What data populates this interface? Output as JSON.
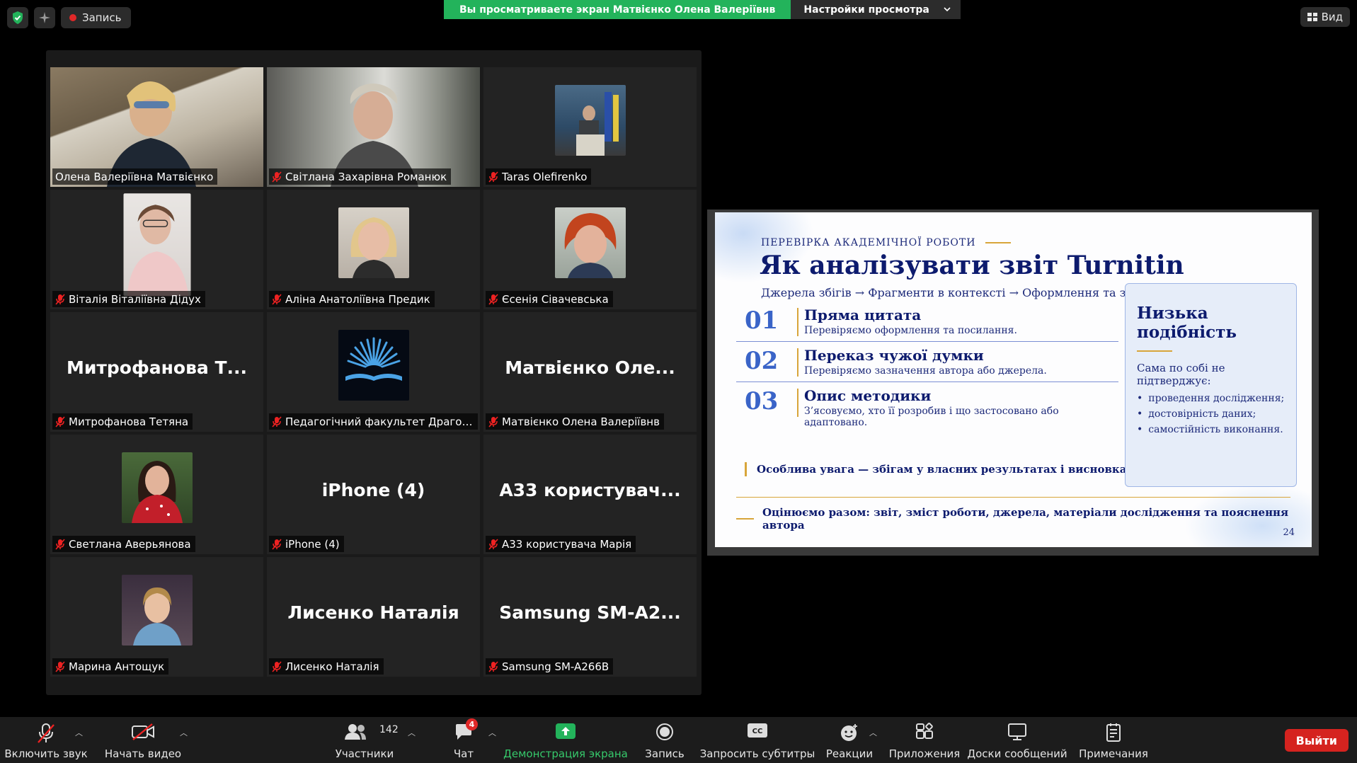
{
  "top": {
    "recording_label": "Запись",
    "share_banner": "Вы просматриваете экран Матвієнко Олена Валеріївнв",
    "view_settings": "Настройки просмотра",
    "view_label": "Вид"
  },
  "tiles": [
    {
      "display_name": "Олена Валеріївна Матвієнко",
      "type": "video",
      "muted": false,
      "active": true
    },
    {
      "display_name": "Світлана Захарівна Романюк",
      "type": "video",
      "muted": true
    },
    {
      "display_name": "Taras Olefirenko",
      "type": "photo",
      "muted": true
    },
    {
      "display_name": "Віталія Віталіївна Дідух",
      "type": "photo",
      "muted": true
    },
    {
      "display_name": "Аліна Анатоліївна Предик",
      "type": "photo",
      "muted": true
    },
    {
      "display_name": "Єсенія Сівачевська",
      "type": "photo",
      "muted": true
    },
    {
      "display_name": "Митрофанова Тетяна",
      "big_text": "Митрофанова Т...",
      "type": "text",
      "muted": true
    },
    {
      "display_name": "Педагогічний факультет Драгомано...",
      "type": "logo",
      "muted": true
    },
    {
      "display_name": "Матвієнко Олена Валеріївнв",
      "big_text": "Матвієнко Оле...",
      "type": "text",
      "muted": true
    },
    {
      "display_name": "Светлана Аверьянова",
      "type": "photo",
      "muted": true
    },
    {
      "display_name": "iPhone (4)",
      "big_text": "iPhone (4)",
      "type": "text",
      "muted": true
    },
    {
      "display_name": "А33 користувача Марія",
      "big_text": "А33  користувач...",
      "type": "text",
      "muted": true
    },
    {
      "display_name": "Марина Антощук",
      "type": "photo",
      "muted": true
    },
    {
      "display_name": "Лисенко Наталія",
      "big_text": "Лисенко Наталія",
      "type": "text",
      "muted": true
    },
    {
      "display_name": "Samsung SM-A266B",
      "big_text": "Samsung  SM-A2...",
      "type": "text",
      "muted": true
    }
  ],
  "slide": {
    "kicker": "ПЕРЕВІРКА АКАДЕМІЧНОЇ РОБОТИ",
    "title": "Як аналізувати звіт Turnitin",
    "subtitle": "Джерела збігів  →  Фрагменти в контексті  →  Оформлення та зміст",
    "items": [
      {
        "num": "01",
        "head": "Пряма цитата",
        "desc": "Перевіряємо оформлення та посилання."
      },
      {
        "num": "02",
        "head": "Переказ чужої думки",
        "desc": "Перевіряємо зазначення автора або джерела."
      },
      {
        "num": "03",
        "head": "Опис методики",
        "desc": "З’ясовуємо, хто її розробив і що застосовано або адаптовано."
      }
    ],
    "note": "Особлива увага — збігам у власних результатах і висновках",
    "box": {
      "title": "Низька подібність",
      "lead": "Сама по собі не підтверджує:",
      "bullets": [
        "проведення дослідження;",
        "достовірність даних;",
        "самостійність виконання."
      ]
    },
    "footer": "Оцінюємо разом: звіт, зміст роботи, джерела, матеріали дослідження та пояснення автора",
    "page": "24"
  },
  "toolbar": {
    "mute": "Включить звук",
    "video": "Начать видео",
    "participants": "Участники",
    "participants_count": "142",
    "chat": "Чат",
    "chat_badge": "4",
    "share": "Демонстрация экрана",
    "record": "Запись",
    "captions": "Запросить субтитры",
    "reactions": "Реакции",
    "apps": "Приложения",
    "whiteboards": "Доски сообщений",
    "notes": "Примечания",
    "leave": "Выйти"
  },
  "colors": {
    "active_speaker": "#d8e83b",
    "share_banner": "#23b35b",
    "leave": "#d5231f",
    "slide_navy": "#0d1b6e",
    "slide_gold": "#d8a53a"
  }
}
